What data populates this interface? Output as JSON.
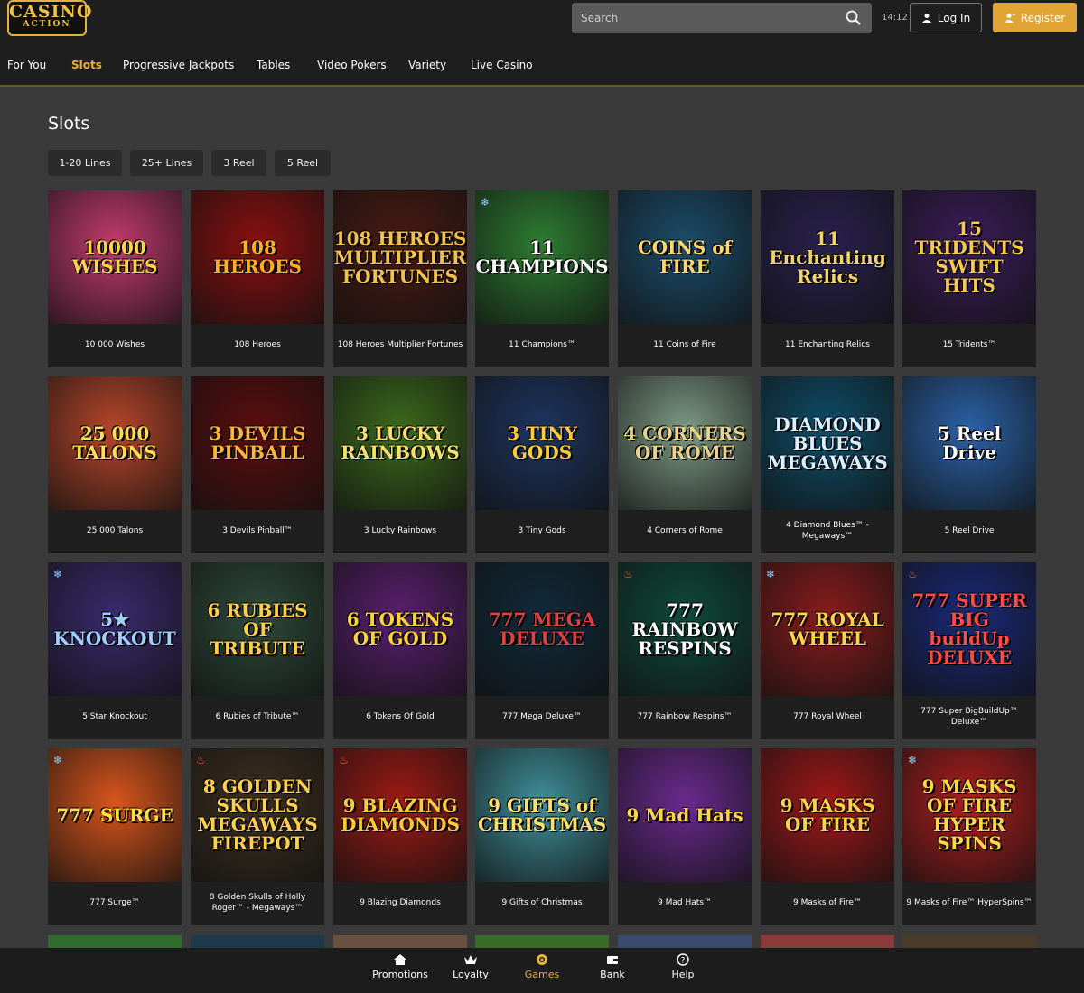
{
  "header": {
    "logo_line1": "CASINO",
    "logo_line2": "ACTION",
    "search_placeholder": "Search",
    "time": "14:12",
    "login_label": "Log In",
    "register_label": "Register"
  },
  "nav": {
    "items": [
      "For You",
      "Slots",
      "Progressive Jackpots",
      "Tables",
      "Video Pokers",
      "Variety",
      "Live Casino"
    ],
    "active": "Slots"
  },
  "page": {
    "title": "Slots",
    "filters": [
      "1-20 Lines",
      "25+ Lines",
      "3 Reel",
      "5 Reel"
    ]
  },
  "games": [
    {
      "name": "10 000 Wishes",
      "art": "10000 WISHES",
      "bg": "#c43a6e",
      "fg": "#ffd34a"
    },
    {
      "name": "108 Heroes",
      "art": "108 HEROES",
      "bg": "#8a1010",
      "fg": "#ffb020"
    },
    {
      "name": "108 Heroes Multiplier Fortunes",
      "art": "108 HEROES MULTIPLIER FORTUNES",
      "bg": "#4a1a12",
      "fg": "#f2c14e"
    },
    {
      "name": "11 Champions™",
      "art": "11 CHAMPIONS",
      "bg": "#2e7d32",
      "fg": "#ffffff",
      "badge": "snow"
    },
    {
      "name": "11 Coins of Fire",
      "art": "COINS of FIRE",
      "bg": "#1b4d6b",
      "fg": "#ffd76a"
    },
    {
      "name": "11 Enchanting Relics",
      "art": "11 Enchanting Relics",
      "bg": "#2a2150",
      "fg": "#f3d36b"
    },
    {
      "name": "15 Tridents™",
      "art": "15 TRIDENTS SWIFT HITS",
      "bg": "#3b1d5a",
      "fg": "#f8c94a"
    },
    {
      "name": "25 000 Talons",
      "art": "25 000 TALONS",
      "bg": "#b8462a",
      "fg": "#ffdd55"
    },
    {
      "name": "3 Devils Pinball™",
      "art": "3 DEVILS PINBALL",
      "bg": "#5c0d0d",
      "fg": "#ffb43a"
    },
    {
      "name": "3 Lucky Rainbows",
      "art": "3 LUCKY RAINBOWS",
      "bg": "#3c6b1c",
      "fg": "#f7e070"
    },
    {
      "name": "3 Tiny Gods",
      "art": "3 TINY GODS",
      "bg": "#1d3560",
      "fg": "#ffcc33"
    },
    {
      "name": "4 Corners of Rome",
      "art": "4 CORNERS OF ROME",
      "bg": "#7d9a86",
      "fg": "#e8d58a"
    },
    {
      "name": "4 Diamond Blues™ - Megaways™",
      "art": "DIAMOND BLUES MEGAWAYS",
      "bg": "#0e4e6a",
      "fg": "#d8f0ff"
    },
    {
      "name": "5 Reel Drive",
      "art": "5 Reel Drive",
      "bg": "#2a62a8",
      "fg": "#ffffff"
    },
    {
      "name": "5 Star Knockout",
      "art": "5★ KNOCKOUT",
      "bg": "#3a2a6e",
      "fg": "#9fd0ff",
      "badge": "snow"
    },
    {
      "name": "6 Rubies of Tribute™",
      "art": "6 RUBIES OF TRIBUTE",
      "bg": "#2d4a3a",
      "fg": "#ffcf4a"
    },
    {
      "name": "6 Tokens Of Gold",
      "art": "6 TOKENS OF GOLD",
      "bg": "#5a1f6e",
      "fg": "#ffd23a"
    },
    {
      "name": "777 Mega Deluxe™",
      "art": "777 MEGA DELUXE",
      "bg": "#102a3a",
      "fg": "#e04040"
    },
    {
      "name": "777 Rainbow Respins™",
      "art": "777 RAINBOW RESPINS",
      "bg": "#0e4a3a",
      "fg": "#ffffff",
      "badge": "hot"
    },
    {
      "name": "777 Royal Wheel",
      "art": "777 ROYAL WHEEL",
      "bg": "#8a1c1c",
      "fg": "#ffd24a",
      "badge": "snow"
    },
    {
      "name": "777 Super BigBuildUp™ Deluxe™",
      "art": "777 SUPER BIG buildUp DELUXE",
      "bg": "#1a2a7a",
      "fg": "#ff4a4a",
      "badge": "hot"
    },
    {
      "name": "777 Surge™",
      "art": "777 SURGE",
      "bg": "#d9551c",
      "fg": "#ffe04a",
      "badge": "snow"
    },
    {
      "name": "8 Golden Skulls of Holly Roger™ - Megaways™",
      "art": "8 GOLDEN SKULLS MEGAWAYS FIREPOT",
      "bg": "#3d3020",
      "fg": "#ffd04a",
      "badge": "hot"
    },
    {
      "name": "9 Blazing Diamonds",
      "art": "9 BLAZING DIAMONDS",
      "bg": "#9e1a14",
      "fg": "#ffca3a",
      "badge": "hot"
    },
    {
      "name": "9 Gifts of Christmas",
      "art": "9 GIFTS of CHRISTMAS",
      "bg": "#3f8f9a",
      "fg": "#ffe06a"
    },
    {
      "name": "9 Mad Hats™",
      "art": "9 Mad Hats",
      "bg": "#6a2a8e",
      "fg": "#ffd34a"
    },
    {
      "name": "9 Masks of Fire™",
      "art": "9 MASKS OF FIRE",
      "bg": "#a01818",
      "fg": "#ffd24a"
    },
    {
      "name": "9 Masks of Fire™ HyperSpins™",
      "art": "9 MASKS OF FIRE HYPER SPINS",
      "bg": "#b01e1e",
      "fg": "#ffd84a",
      "badge": "snow"
    }
  ],
  "peek_colors": [
    "#2f6a2f",
    "#1e3a4a",
    "#6a5040",
    "#3a6a2a",
    "#3a4a6a",
    "#8a3a3a",
    "#4a3a2a"
  ],
  "badges": {
    "snow": "❄",
    "hot": "♨"
  },
  "bottom_nav": {
    "items": [
      "Promotions",
      "Loyalty",
      "Games",
      "Bank",
      "Help"
    ],
    "active": "Games"
  },
  "colors": {
    "accent": "#e8b233",
    "register_bg": "#e0a534"
  }
}
